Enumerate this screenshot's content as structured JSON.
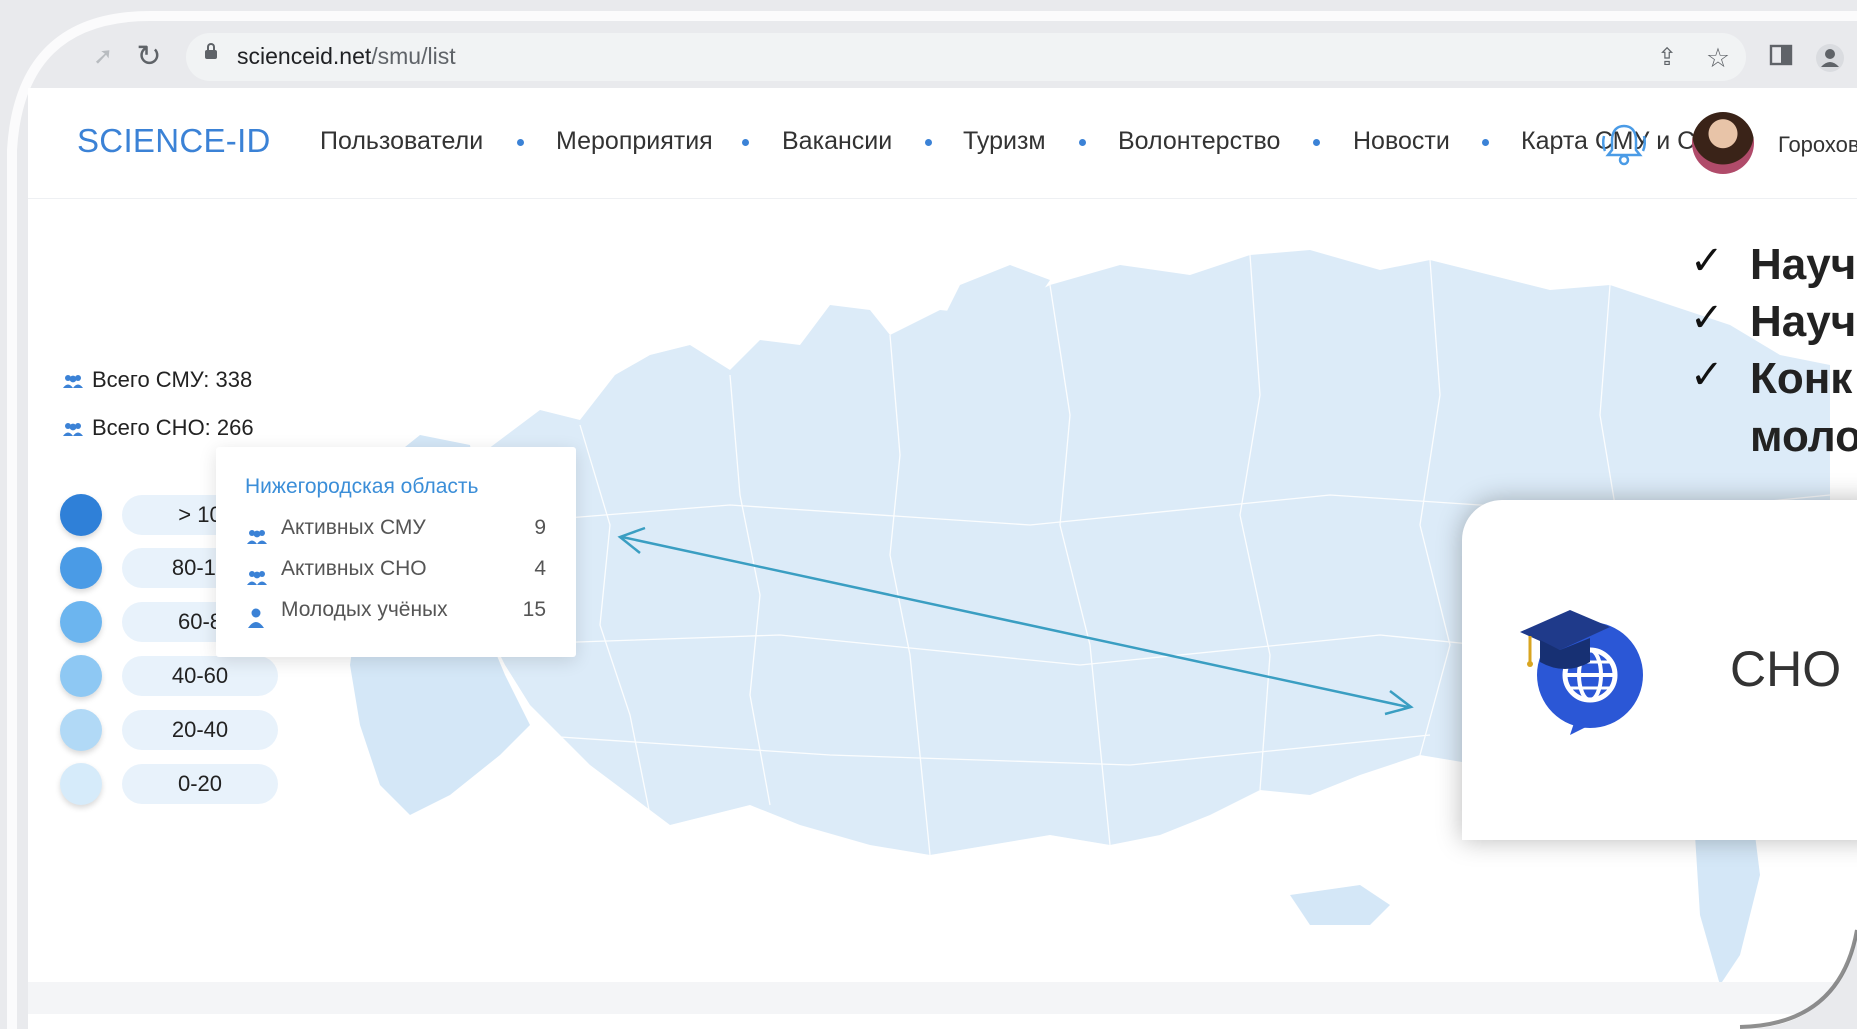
{
  "browser": {
    "url_host": "scienceid.net",
    "url_path": "/smu/list"
  },
  "header": {
    "logo": "SCIENCE-ID",
    "nav": [
      "Пользователи",
      "Мероприятия",
      "Вакансии",
      "Туризм",
      "Волонтерство",
      "Новости",
      "Карта СМУ и С"
    ],
    "user_name": "Горохов"
  },
  "stats": {
    "smu": "Всего СМУ: 338",
    "sno": "Всего СНО: 266"
  },
  "legend": [
    {
      "label": "> 10",
      "color": "#2f80d8"
    },
    {
      "label": "80-10",
      "color": "#4a9be6"
    },
    {
      "label": "60-8",
      "color": "#6cb5ef"
    },
    {
      "label": "40-60",
      "color": "#8ec8f3"
    },
    {
      "label": "20-40",
      "color": "#b1d9f6"
    },
    {
      "label": "0-20",
      "color": "#d6ebfa"
    }
  ],
  "tooltip": {
    "region": "Нижегородская область",
    "rows": [
      {
        "label": "Активных СМУ",
        "value": "9"
      },
      {
        "label": "Активных СНО",
        "value": "4"
      },
      {
        "label": "Молодых учёных",
        "value": "15"
      }
    ]
  },
  "overlay": {
    "checks": [
      "Науч",
      "Науч",
      "Конк"
    ],
    "check_cont": "моло",
    "card_text": "СНО "
  },
  "colors": {
    "accent": "#3b82d6",
    "map_fill": "#dcebf8",
    "arrow": "#3a9ec2"
  }
}
